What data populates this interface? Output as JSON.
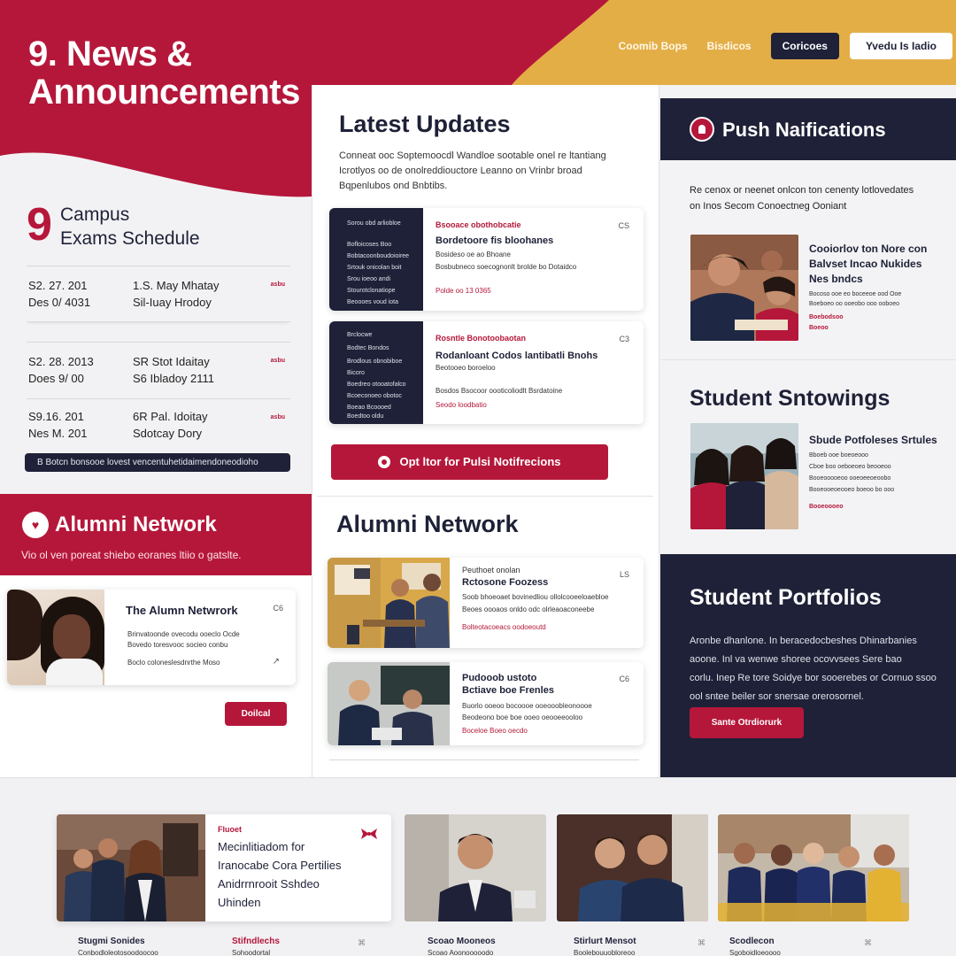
{
  "header": {
    "title_line1": "9. News &",
    "title_line2": "Announcements",
    "nav": [
      "Coomib Bops",
      "Bisdicos"
    ],
    "dark_button": "Coricoes",
    "white_button": "Yvedu Is Iadio"
  },
  "exams": {
    "number": "9",
    "title_line1": "Campus",
    "title_line2": "Exams Schedule",
    "rows": [
      {
        "d1": "S2. 27. 201",
        "d2": "Des 0/ 4031",
        "t1": "1.S. May Mhatay",
        "t2": "Sil-Iuay Hrodoy",
        "tag": "asbu"
      },
      {
        "d1": "S2. 28. 2013",
        "d2": "Does 9/ 00",
        "t1": "SR Stot Idaitay",
        "t2": "S6 Ibladoy 2111",
        "tag": "asbu"
      },
      {
        "d1": "S9.16. 201",
        "d2": "Nes M. 201",
        "t1": "6R Pal. Idoitay",
        "t2": "Sdotcay Dory",
        "tag": "asbu"
      }
    ],
    "bar_text": "B Botcn bonsooe lovest vencentuhetidaimendoneodioho"
  },
  "alumni_left": {
    "title": "Alumni Network",
    "subtitle": "Vio ol ven poreat shiebo eoranes ltiio o gatslte.",
    "card_title": "The Alumn Netwrork",
    "card_num": "C6",
    "card_line1": "Brinvatoonde ovecodu ooeclo Ocde",
    "card_line2": "Bovedo toresvooc socieo conbu",
    "card_line3": "Boclo coloneslesdnrthe Moso",
    "button": "Doilcal"
  },
  "updates": {
    "title": "Latest Updates",
    "desc_line1": "Conneat ooc Soptemoocdl Wandloe sootable onel re ltantiang",
    "desc_line2": "Icrotlyos oo de onolreddiouctore Leanno on Vrinbr broad",
    "desc_line3": "Bqpenlubos ond Bnbtibs.",
    "cards": [
      {
        "side": [
          "Sorou obd arliobloe",
          "Bofloicoses Boo",
          "Bobtacoonboudoioiree",
          "Srtouk onicolan boit",
          "Srou ioeoo andi",
          "Stourotclonatiope",
          "Beoooes voud iota"
        ],
        "red_title": "Bsooace obothobcatie",
        "heading": "Bordetoore fis bloohanes",
        "line1": "Bosideso oe ao Bhoane",
        "line2": "Bosbubneco soecognonlt brolde bo Dotaidco",
        "footer": "Polde oo 13 0365",
        "num": "CS"
      },
      {
        "side": [
          "Brclocwe",
          "Bodtec Bondos",
          "Brodlous obnobiboe",
          "Bicoro",
          "Boedreo otooatofalco",
          "Bcoeconoeo obotoc",
          "Boeao Bcoooed",
          "Boedtoo oldu"
        ],
        "red_title": "Rosntle Bonotoobaotan",
        "heading": "Rodanloant Codos lantibatli Bnohs",
        "line1": "Beotooeo boroeloo",
        "line2": "Bosdos Bsocoor oooticoliodlt Bsrdatoine",
        "footer": "Seodo loodbatio",
        "num": "C3"
      }
    ],
    "opt_button": "Opt ltor for Pulsi Notifrecions"
  },
  "alumni_mid": {
    "title": "Alumni Network",
    "cards": [
      {
        "small": "Peuthoet onolan",
        "heading": "Rctosone Foozess",
        "line1": "Soob bhoeoaet bovinedliou ollolcooeeloaebloe",
        "line2": "Beoes oooaos onldo odc olrleaoaconeebe",
        "line3": "Bolteotacoeacs oodoeoutd",
        "num": "LS"
      },
      {
        "small": "Pudooob ustoto",
        "heading": "Bctiave boe Frenles",
        "line1": "Buorlo ooeoo bocoooe ooeooobleonoooe",
        "line2": "Beodeono boe boe ooeo oeooeeooloo",
        "line3": "Boceloe Boeo oecdo",
        "num": "C6"
      }
    ]
  },
  "push": {
    "title": "Push Naifications",
    "desc_line1": "Re cenox or neenet onlcon ton cenenty lotlovedates",
    "desc_line2": "on Inos Secom Conoectneg Ooniant",
    "card_title_line1": "Cooiorlov ton Nore con",
    "card_title_line2": "Balvset Incao Nukides",
    "card_title_line3": "Nes bndcs",
    "card_line1": "Bocoso ooe eo boceeoe ood Ooe",
    "card_line2": "Boeboeo oo ooeobo ooo ooboeo",
    "card_red1": "Boebodsoo",
    "card_red2": "Boeoo"
  },
  "showings": {
    "title": "Student Sntowings",
    "card_title": "Sbude Potfoleses Srtules",
    "card_line1": "Bboeb ooe boeoeooo",
    "card_line2": "Cboe boo oeboeoeo beooeoo",
    "card_line3": "Booeooooeoo ooeoeeoeoobo",
    "card_line4": "Booeooeoeooeo boeoo bo ooo",
    "card_red": "Booeoooeo"
  },
  "portfolios": {
    "title": "Student Portfolios",
    "desc_line1": "Aronbe dhanlone. In beracedocbeshes Dhinarbanies",
    "desc_line2": "aoone. Inl va wenwe shoree ocovvsees Sere bao",
    "desc_line3": "corlu. Inep Re tore Soidye bor sooerebes or Cornuo ssoo",
    "desc_line4": "ool sntee beiler sor snersae orerosornel.",
    "button": "Sante Otrdiorurk"
  },
  "bottom": {
    "feature_tag": "Fluoet",
    "feature_line1": "Mecinlitiadom for",
    "feature_line2": "Iranocabe Cora Pertilies",
    "feature_line3": "Anidrrnrooit Sshdeo",
    "feature_line4": "Uhinden",
    "captions": [
      {
        "title": "Stugmi Sonides",
        "sub": "Conbodloleotosoodoocoo"
      },
      {
        "title": "Stifndlechs",
        "sub": "Sohoodortal"
      },
      {
        "title": "Scoao Mooneos",
        "sub": "Scoao Aoonooooodo"
      },
      {
        "title": "Stirlurt Mensot",
        "sub": "Boolebouuobloreoo"
      },
      {
        "title": "Scodlecon",
        "sub": "Sgoboidloeoooo"
      }
    ]
  },
  "colors": {
    "crimson": "#b5173a",
    "navy": "#1e2137",
    "gold": "#e4ae47"
  }
}
